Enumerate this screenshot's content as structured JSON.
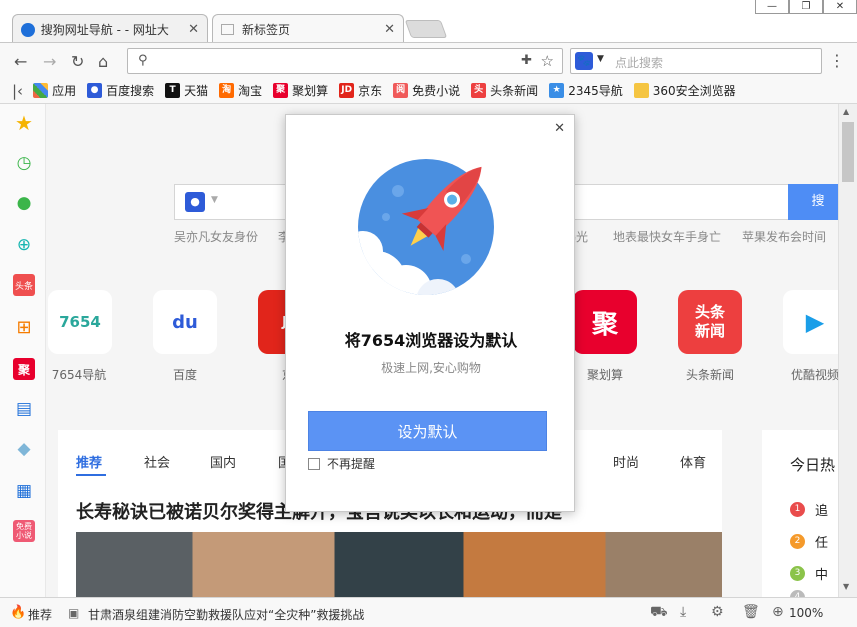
{
  "tabs": [
    {
      "title": "搜狗网址导航 - - 网址大",
      "active": false
    },
    {
      "title": "新标签页",
      "active": true
    }
  ],
  "toolbar": {
    "address_value": "",
    "search_placeholder": "点此搜索"
  },
  "bookmarks": [
    {
      "label": "应用",
      "icon": "apps-grid-icon",
      "color": "#e64"
    },
    {
      "label": "百度搜索",
      "icon": "baidu-paw-icon",
      "color": "#2e5bd8"
    },
    {
      "label": "天猫",
      "icon": "tmall-icon",
      "color": "#d8000f"
    },
    {
      "label": "淘宝",
      "icon": "taobao-icon",
      "color": "#ff6a00"
    },
    {
      "label": "聚划算",
      "icon": "juhuasuan-icon",
      "color": "#e8002d"
    },
    {
      "label": "京东",
      "icon": "jd-icon",
      "color": "#e1251b"
    },
    {
      "label": "免费小说",
      "icon": "novel-icon",
      "color": "#f05a5a"
    },
    {
      "label": "头条新闻",
      "icon": "toutiao-icon",
      "color": "#ed4040"
    },
    {
      "label": "2345导航",
      "icon": "2345-icon",
      "color": "#3a8ee6"
    },
    {
      "label": "360安全浏览器",
      "icon": "folder-icon",
      "color": "#f5c542"
    }
  ],
  "sidebar_icons": [
    "star-icon",
    "clock-icon",
    "wechat-icon",
    "search-circle-icon",
    "toutiao-icon",
    "cart-icon",
    "juhuasuan-icon",
    "film-icon",
    "tag-icon",
    "calculator-icon",
    "free-novel-icon"
  ],
  "sidebar_texts": {
    "toutiao": "头条",
    "ju": "聚",
    "novel": "免费\n小说"
  },
  "hot_searches": [
    "吴亦凡女友身份",
    "李",
    "曝光",
    "地表最快女车手身亡",
    "苹果发布会时间"
  ],
  "search_button": "搜",
  "tiles": [
    {
      "label": "7654导航",
      "text": "7654"
    },
    {
      "label": "百度",
      "text": "du"
    },
    {
      "label": "京",
      "text": "JD"
    },
    {
      "label": "聚划算",
      "text": "聚"
    },
    {
      "label": "头条新闻",
      "text": "头条\n新闻"
    },
    {
      "label": "优酷视频",
      "text": "▶"
    }
  ],
  "news": {
    "tabs": [
      "推荐",
      "社会",
      "国内",
      "国",
      "时尚",
      "体育"
    ],
    "headline": "长寿秘诀已被诺贝尔奖得主解开，宝吾说美以长和运动，而是",
    "hot_title": "今日热",
    "hot_items": [
      {
        "rank": "1",
        "text": "追",
        "color": "#e94c4c"
      },
      {
        "rank": "2",
        "text": "任",
        "color": "#f59a2b"
      },
      {
        "rank": "3",
        "text": "中",
        "color": "#8bc34a"
      },
      {
        "rank": "4",
        "text": "",
        "color": "#bbbbbb"
      }
    ]
  },
  "dialog": {
    "title": "将7654浏览器设为默认",
    "subtitle": "极速上网,安心购物",
    "button": "设为默认",
    "checkbox": "不再提醒"
  },
  "statusbar": {
    "recommend": "推荐",
    "news": "甘肃酒泉组建消防空勤救援队应对“全灾种”救援挑战",
    "zoom": "100%"
  }
}
